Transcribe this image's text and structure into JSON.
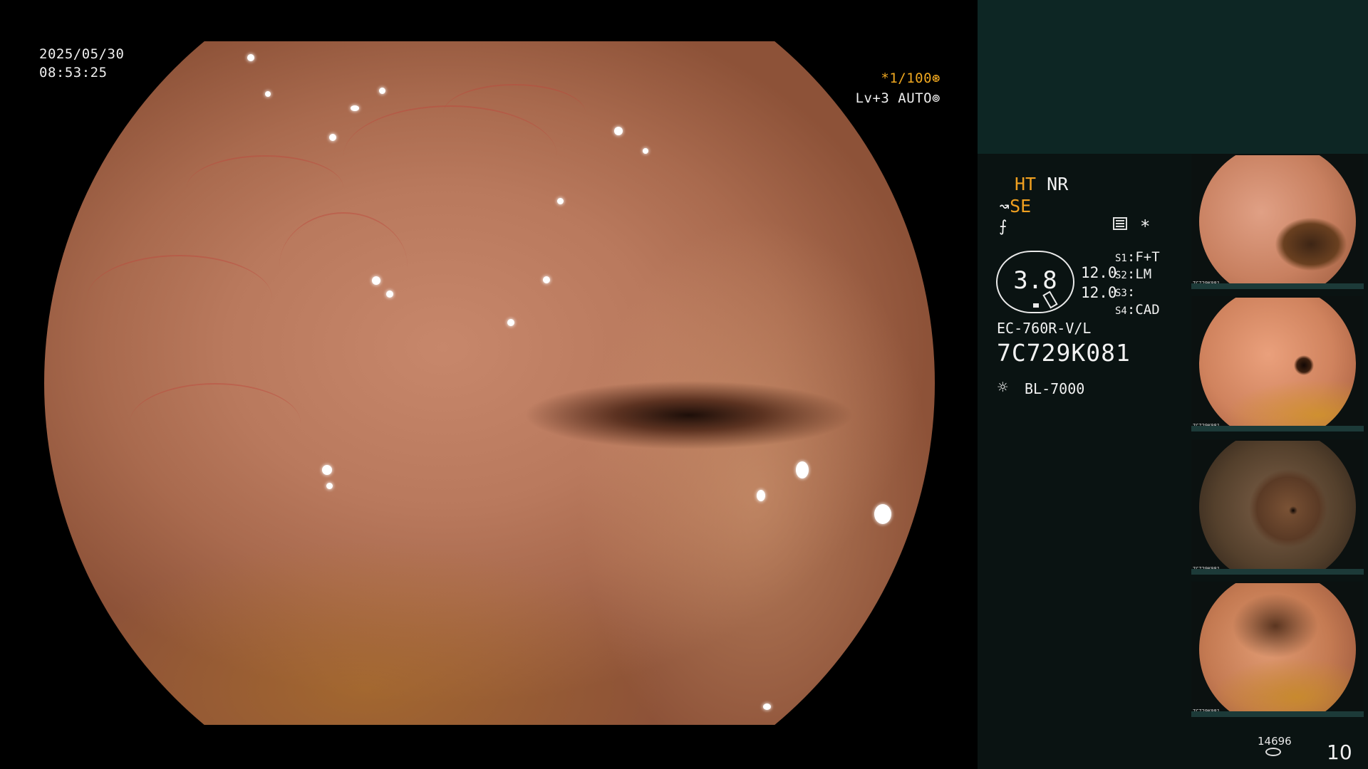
{
  "endoscope": {
    "date": "2025/05/30",
    "time": "08:53:25",
    "shutter": "*1/100⊛",
    "level": "Lv+3 AUTO⊚"
  },
  "panel": {
    "ht_label": "HT",
    "nr_label": "NR",
    "se_label": "SE",
    "se_icon": "↝",
    "filter_icon": "⨍",
    "star": "*",
    "gauge_value": "3.8",
    "value_a": "12.0",
    "value_b": "12.0",
    "s_settings": [
      {
        "key": "S1",
        "value": "F+T"
      },
      {
        "key": "S2",
        "value": "LM"
      },
      {
        "key": "S3",
        "value": ""
      },
      {
        "key": "S4",
        "value": "CAD"
      }
    ],
    "scope_model": "EC-760R-V/L",
    "serial": "7C729K081",
    "light_icon": "☼",
    "light_source": "BL-7000",
    "storage_count": "14696",
    "image_count": "10",
    "thumbnails": [
      {
        "label": "7C729K081"
      },
      {
        "label": "7C729K081"
      },
      {
        "label": "7C729K081"
      },
      {
        "label": "7C729K081"
      }
    ]
  },
  "colors": {
    "background": "#000000",
    "panel_top": "#0d2624",
    "panel": "#0a1312",
    "accent_orange": "#f0a020"
  },
  "icons": [
    "menu-icon",
    "star-icon",
    "filter-icon",
    "light-icon",
    "storage-icon"
  ]
}
